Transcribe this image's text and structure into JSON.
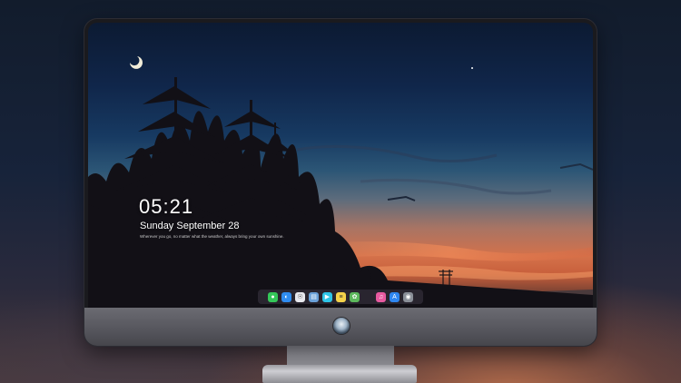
{
  "lock_screen": {
    "time": "05:21",
    "date": "Sunday September  28",
    "tagline": "Wherever you go, no matter what the weather, always bring your own sunshine."
  },
  "dock": {
    "apps": [
      {
        "name": "messages-icon",
        "glyph": "●",
        "color": "#34c759"
      },
      {
        "name": "finder-icon",
        "glyph": "◐",
        "color": "#2f8cf0"
      },
      {
        "name": "safari-icon",
        "glyph": "☉",
        "color": "#e8e8ee"
      },
      {
        "name": "preview-icon",
        "glyph": "▤",
        "color": "#6aa0d8"
      },
      {
        "name": "video-icon",
        "glyph": "▶",
        "color": "#2ec5e8"
      },
      {
        "name": "notes-icon",
        "glyph": "≡",
        "color": "#f5d24a"
      },
      {
        "name": "photos-icon",
        "glyph": "✿",
        "color": "#5cb85c"
      },
      {
        "name": "music-icon",
        "glyph": "♫",
        "color": "#e85aa0"
      },
      {
        "name": "app-store-icon",
        "glyph": "A",
        "color": "#2e86f0"
      },
      {
        "name": "camera-icon",
        "glyph": "◉",
        "color": "#8a8f98"
      }
    ]
  },
  "colors": {
    "sky_top": "#0c1a32",
    "horizon": "#d4714a",
    "monitor_chin": "#5b5b62"
  }
}
